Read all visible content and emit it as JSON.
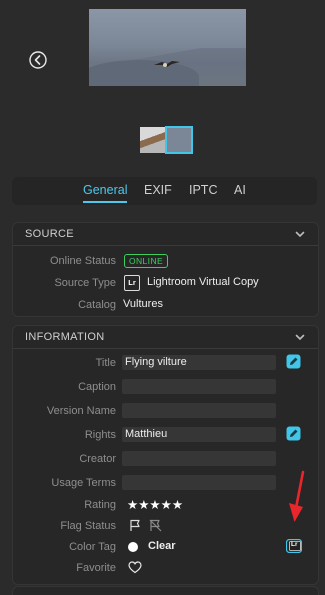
{
  "tabs": [
    {
      "label": "General",
      "active": true
    },
    {
      "label": "EXIF"
    },
    {
      "label": "IPTC"
    },
    {
      "label": "AI"
    }
  ],
  "source": {
    "title": "SOURCE",
    "online_status_label": "Online Status",
    "online_status_value": "ONLINE",
    "source_type_label": "Source Type",
    "source_type_icon": "Lr",
    "source_type_value": "Lightroom Virtual Copy",
    "catalog_label": "Catalog",
    "catalog_value": "Vultures"
  },
  "information": {
    "title": "INFORMATION",
    "title_label": "Title",
    "title_value": "Flying vilture",
    "caption_label": "Caption",
    "caption_value": "",
    "version_name_label": "Version Name",
    "version_name_value": "",
    "rights_label": "Rights",
    "rights_value": "Matthieu",
    "creator_label": "Creator",
    "creator_value": "",
    "usage_terms_label": "Usage Terms",
    "usage_terms_value": "",
    "rating_label": "Rating",
    "rating_stars": "★★★★★",
    "rating_value": 5,
    "flag_status_label": "Flag Status",
    "color_tag_label": "Color Tag",
    "color_tag_value": "Clear",
    "favorite_label": "Favorite",
    "lr_tag_icon": "Lr"
  },
  "colors": {
    "accent": "#4fc7ea",
    "online": "#3ccf60",
    "annotation_arrow": "#e8262b"
  },
  "icons": [
    "back-icon",
    "chevron-down-icon",
    "edit-icon",
    "lightroom-icon",
    "flag-icon",
    "unflag-icon",
    "heart-icon"
  ]
}
